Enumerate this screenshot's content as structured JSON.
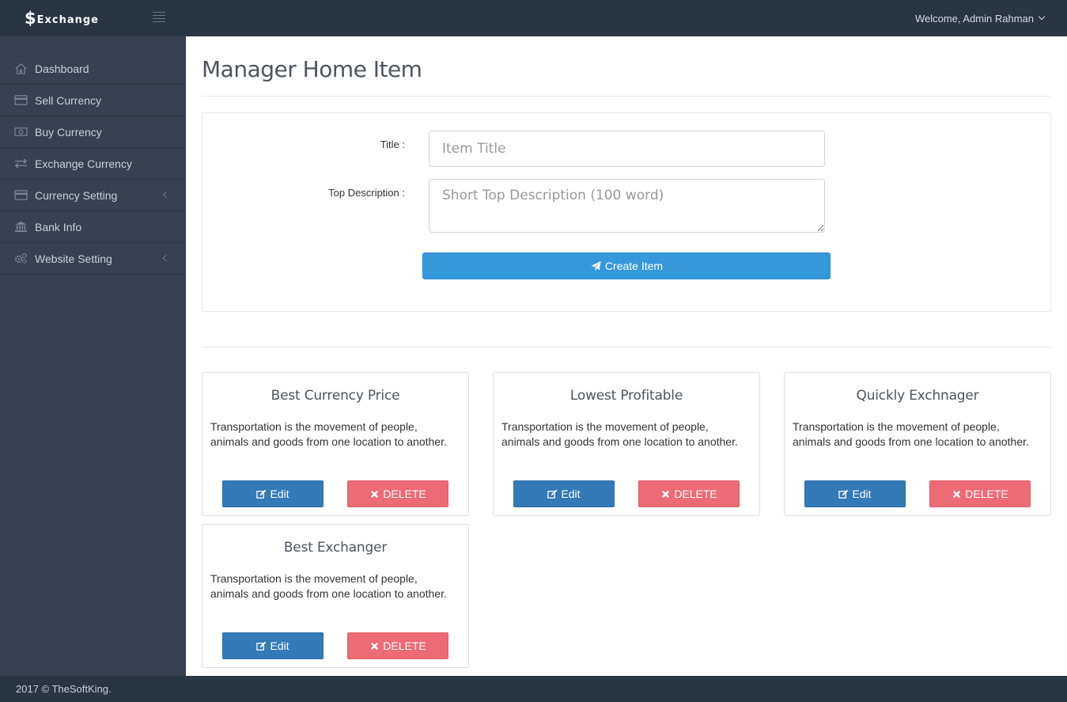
{
  "topbar": {
    "brand_symbol": "$",
    "brand_name": "Exchange",
    "welcome": "Welcome, Admin Rahman"
  },
  "sidebar": {
    "items": [
      {
        "label": "Dashboard",
        "icon": "home-icon",
        "has_submenu": false
      },
      {
        "label": "Sell Currency",
        "icon": "credit-card-icon",
        "has_submenu": false
      },
      {
        "label": "Buy Currency",
        "icon": "money-icon",
        "has_submenu": false
      },
      {
        "label": "Exchange Currency",
        "icon": "exchange-arrows-icon",
        "has_submenu": false
      },
      {
        "label": "Currency Setting",
        "icon": "credit-card-icon",
        "has_submenu": true
      },
      {
        "label": "Bank Info",
        "icon": "bank-icon",
        "has_submenu": false
      },
      {
        "label": "Website Setting",
        "icon": "gears-icon",
        "has_submenu": true
      }
    ]
  },
  "main": {
    "title": "Manager Home Item",
    "form": {
      "title_label": "Title :",
      "title_placeholder": "Item Title",
      "desc_label": "Top Description :",
      "desc_placeholder": "Short Top Description (100 word)",
      "submit_label": "Create Item"
    },
    "cards": [
      {
        "title": "Best Currency Price",
        "description": "Transportation is the movement of people, animals and goods from one location to another.",
        "edit_label": "Edit",
        "delete_label": "DELETE"
      },
      {
        "title": "Lowest Profitable",
        "description": "Transportation is the movement of people, animals and goods from one location to another.",
        "edit_label": "Edit",
        "delete_label": "DELETE"
      },
      {
        "title": "Quickly Exchnager",
        "description": "Transportation is the movement of people, animals and goods from one location to another.",
        "edit_label": "Edit",
        "delete_label": "DELETE"
      },
      {
        "title": "Best Exchanger",
        "description": "Transportation is the movement of people, animals and goods from one location to another.",
        "edit_label": "Edit",
        "delete_label": "DELETE"
      }
    ]
  },
  "footer": {
    "text": "2017 © TheSoftKing."
  },
  "colors": {
    "topbar": "#2a3542",
    "sidebar": "#37414f",
    "primary": "#3498db",
    "edit": "#337ab7",
    "delete": "#ed6b75"
  }
}
